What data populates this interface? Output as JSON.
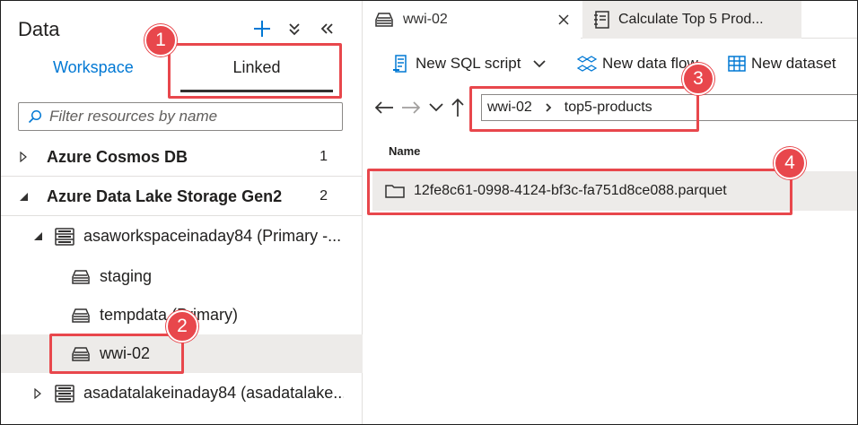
{
  "left_panel": {
    "title": "Data",
    "actions": [
      {
        "name": "add",
        "icon": "plus-icon",
        "glyph": "+"
      },
      {
        "name": "collapse-all",
        "icon": "double-chevron-down-icon",
        "glyph": "⌄⌄"
      },
      {
        "name": "collapse-panel",
        "icon": "double-chevron-left-icon",
        "glyph": "«"
      }
    ],
    "tabs": {
      "workspace": "Workspace",
      "linked": "Linked"
    },
    "filter_placeholder": "Filter resources by name",
    "tree": {
      "cosmos": {
        "label": "Azure Cosmos DB",
        "count": "1"
      },
      "adls": {
        "label": "Azure Data Lake Storage Gen2",
        "count": "2"
      },
      "account1": {
        "label": "asaworkspaceinaday84 (Primary -..."
      },
      "containers": [
        "staging",
        "tempdata (Primary)",
        "wwi-02"
      ],
      "account2": {
        "label": "asadatalakeinaday84 (asadatalake..."
      }
    }
  },
  "right_panel": {
    "tabs": [
      {
        "label": "wwi-02",
        "icon": "container-icon"
      },
      {
        "label": "Calculate Top 5 Prod...",
        "icon": "notebook-icon"
      }
    ],
    "toolbar": {
      "new_sql_script": "New SQL script",
      "new_data_flow": "New data flow",
      "new_dataset": "New dataset"
    },
    "breadcrumb": [
      "wwi-02",
      "top5-products"
    ],
    "list_header": "Name",
    "files": [
      {
        "name": "12fe8c61-0998-4124-bf3c-fa751d8ce088.parquet",
        "icon": "folder-icon"
      }
    ]
  },
  "callouts": [
    "1",
    "2",
    "3",
    "4"
  ],
  "colors": {
    "accent": "#0078d4",
    "callout": "#e8474c",
    "selected": "#edebe9"
  }
}
